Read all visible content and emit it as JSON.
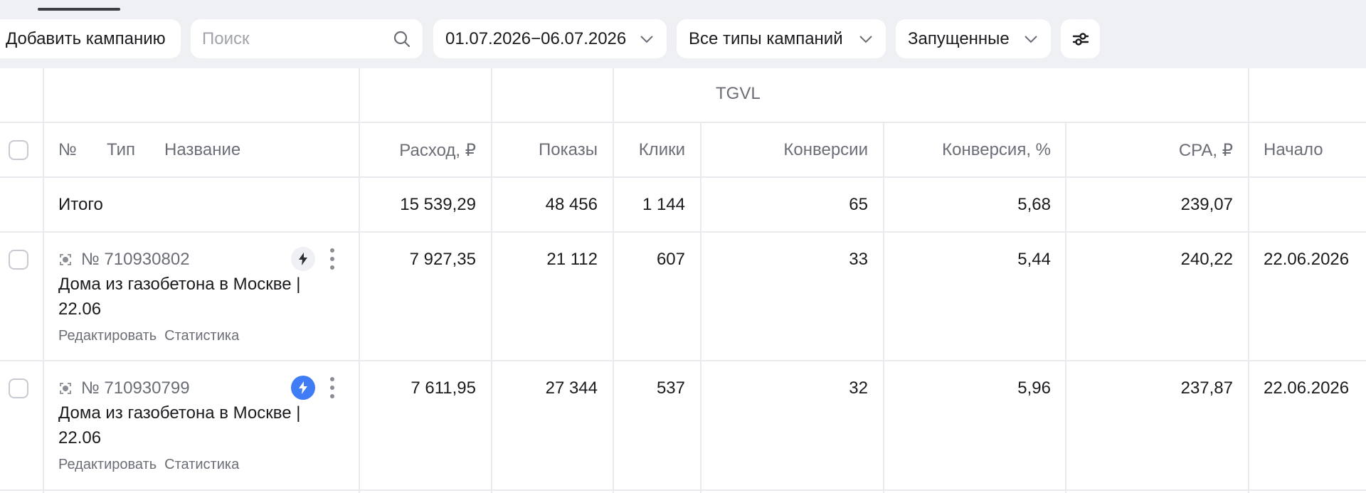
{
  "toolbar": {
    "add_campaign": "Добавить кампанию",
    "search_placeholder": "Поиск",
    "date_range": "01.07.2026−06.07.2026",
    "campaign_types": "Все типы кампаний",
    "status_filter": "Запущенные"
  },
  "table": {
    "group_header": "TGVL",
    "headers": {
      "num": "№",
      "type": "Тип",
      "name": "Название",
      "spend": "Расход, ₽",
      "impressions": "Показы",
      "clicks": "Клики",
      "conversions": "Конверсии",
      "conversion_rate": "Конверсия, %",
      "cpa": "CPA, ₽",
      "start": "Начало"
    },
    "total": {
      "label": "Итого",
      "spend": "15 539,29",
      "impressions": "48 456",
      "clicks": "1 144",
      "conversions": "65",
      "conversion_rate": "5,68",
      "cpa": "239,07"
    },
    "rows": [
      {
        "id": "№ 710930802",
        "name": "Дома из газобетона в Москве | 22.06",
        "edit": "Редактировать",
        "stats": "Статистика",
        "spend": "7 927,35",
        "impressions": "21 112",
        "clicks": "607",
        "conversions": "33",
        "conversion_rate": "5,44",
        "cpa": "240,22",
        "start": "22.06.2026",
        "bolt_icon": "bolt-icon",
        "bolt_color": "#eef0f3"
      },
      {
        "id": "№ 710930799",
        "name": "Дома из газобетона в Москве | 22.06",
        "edit": "Редактировать",
        "stats": "Статистика",
        "spend": "7 611,95",
        "impressions": "27 344",
        "clicks": "537",
        "conversions": "32",
        "conversion_rate": "5,96",
        "cpa": "237,87",
        "start": "22.06.2026",
        "bolt_icon": "bolt-icon",
        "bolt_color": "#3f7cf5"
      }
    ]
  }
}
